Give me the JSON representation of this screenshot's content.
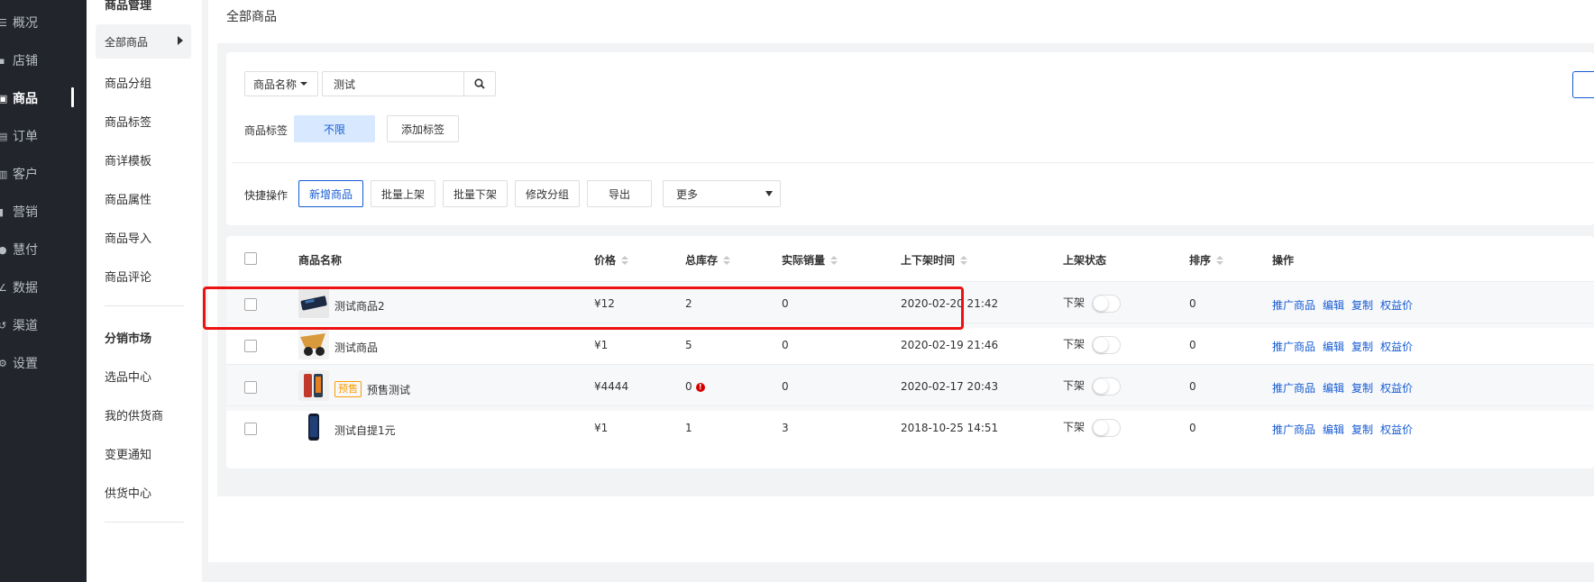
{
  "nav": {
    "items": [
      {
        "icon": "overview-icon",
        "label": "概况"
      },
      {
        "icon": "store-icon",
        "label": "店铺"
      },
      {
        "icon": "goods-icon",
        "label": "商品"
      },
      {
        "icon": "order-icon",
        "label": "订单"
      },
      {
        "icon": "customer-icon",
        "label": "客户"
      },
      {
        "icon": "marketing-icon",
        "label": "营销"
      },
      {
        "icon": "payment-icon",
        "label": "慧付"
      },
      {
        "icon": "data-icon",
        "label": "数据"
      },
      {
        "icon": "channel-icon",
        "label": "渠道"
      },
      {
        "icon": "settings-icon",
        "label": "设置"
      }
    ],
    "active": "商品"
  },
  "subnav": {
    "section1_title": "商品管理",
    "active_item": "全部商品",
    "items1": [
      "商品分组",
      "商品标签",
      "商详模板",
      "商品属性",
      "商品导入",
      "商品评论"
    ],
    "section2_title": "分销市场",
    "items2": [
      "选品中心",
      "我的供货商",
      "变更通知",
      "供货中心"
    ]
  },
  "main": {
    "page_title": "全部商品"
  },
  "filter": {
    "field_select": "商品名称",
    "search_value": "测试",
    "tag_label": "商品标签",
    "tag_unlimited": "不限",
    "tag_add": "添加标签"
  },
  "quick": {
    "label": "快捷操作",
    "buttons": [
      "新增商品",
      "批量上架",
      "批量下架",
      "修改分组",
      "导出"
    ],
    "more": "更多"
  },
  "table": {
    "headers": {
      "name": "商品名称",
      "price": "价格",
      "stock": "总库存",
      "sales": "实际销量",
      "time": "上下架时间",
      "status": "上架状态",
      "rank": "排序",
      "ops": "操作"
    },
    "rows": [
      {
        "name": "测试商品2",
        "tag": "",
        "price": "¥12",
        "stock": "2",
        "sales": "0",
        "time": "2020-02-20 21:42",
        "status": "下架",
        "rank": "0"
      },
      {
        "name": "测试商品",
        "tag": "",
        "price": "¥1",
        "stock": "5",
        "sales": "0",
        "time": "2020-02-19 21:46",
        "status": "下架",
        "rank": "0"
      },
      {
        "name": "预售测试",
        "tag": "预售",
        "price": "¥4444",
        "stock": "0",
        "sales": "0",
        "time": "2020-02-17 20:43",
        "status": "下架",
        "rank": "0"
      },
      {
        "name": "测试自提1元",
        "tag": "",
        "price": "¥1",
        "stock": "1",
        "sales": "3",
        "time": "2018-10-25 14:51",
        "status": "下架",
        "rank": "0"
      }
    ],
    "ops": [
      "推广商品",
      "编辑",
      "复制",
      "权益价"
    ]
  },
  "colors": {
    "accent": "#155bd4",
    "highlight": "#ee1111",
    "presale": "#ff9c00",
    "nav_bg": "#22252c"
  }
}
